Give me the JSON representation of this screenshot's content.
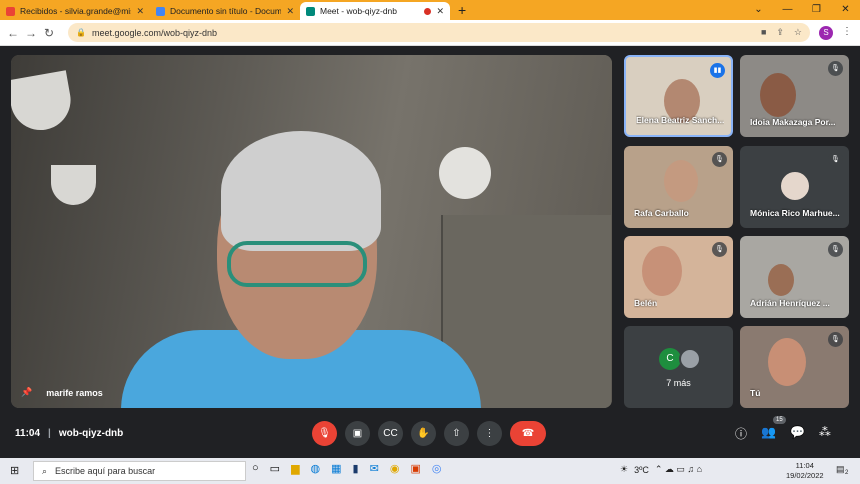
{
  "browser": {
    "tabs": [
      {
        "title": "Recibidos - silvia.grande@misev",
        "icon": "gmail-icon",
        "active": false
      },
      {
        "title": "Documento sin título - Documen",
        "icon": "docs-icon",
        "active": false
      },
      {
        "title": "Meet - wob-qiyz-dnb",
        "icon": "meet-icon",
        "active": true
      }
    ],
    "url": "meet.google.com/wob-qiyz-dnb",
    "profile_initial": "S"
  },
  "meeting": {
    "time": "11:04",
    "code": "wob-qiyz-dnb",
    "participants_badge": "15",
    "main_speaker": "marife ramos",
    "tiles": [
      {
        "name": "Elena Beatriz Sanch...",
        "state": "speaking"
      },
      {
        "name": "Idoia Makazaga Por...",
        "state": "muted"
      },
      {
        "name": "Rafa Carballo",
        "state": "muted"
      },
      {
        "name": "Mónica Rico Marhue...",
        "state": "muted"
      },
      {
        "name": "Belén",
        "state": "muted"
      },
      {
        "name": "Adrián Henríquez ...",
        "state": "muted"
      },
      {
        "name": "7 más",
        "state": "more",
        "avatar_letter": "C"
      },
      {
        "name": "Tú",
        "state": "muted"
      }
    ]
  },
  "taskbar": {
    "search_placeholder": "Escribe aquí para buscar",
    "weather": "3ºC",
    "time": "11:04",
    "date": "19/02/2022",
    "notifications": "2"
  },
  "colors": {
    "tabbar": "#f5a623",
    "end_call": "#ea4335",
    "speaking": "#1a73e8"
  }
}
